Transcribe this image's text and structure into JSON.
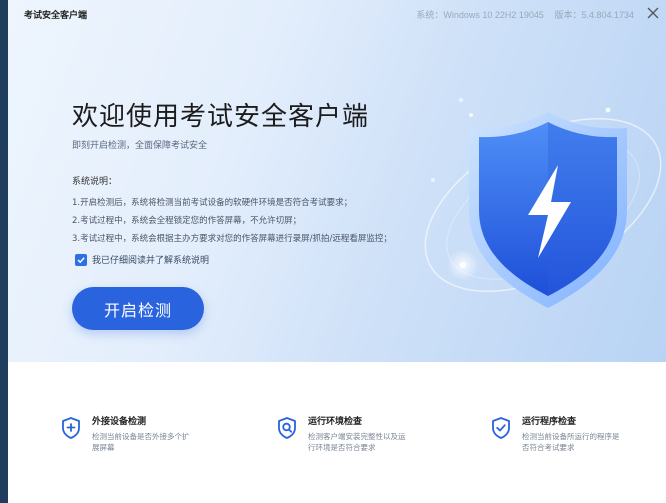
{
  "window": {
    "app_title": "考试安全客户端",
    "system_label": "系统：Windows 10 22H2 19045",
    "version_label": "版本：5.4.804.1734"
  },
  "hero": {
    "title": "欢迎使用考试安全客户端",
    "subtitle": "即刻开启检测，全面保障考试安全",
    "notes_title": "系统说明：",
    "notes": [
      "1.开启检测后，系统将检测当前考试设备的软硬件环境是否符合考试要求；",
      "2.考试过程中，系统会全程锁定您的作答屏幕，不允许切屏；",
      "3.考试过程中，系统会根据主办方要求对您的作答屏幕进行录屏/抓拍/远程看屏监控；"
    ],
    "agree_label": "我已仔细阅读并了解系统说明",
    "agree_checked": true,
    "start_button": "开启检测"
  },
  "features": [
    {
      "icon": "shield-plus-icon",
      "title": "外接设备检测",
      "desc": "检测当前设备是否外接多个扩展屏幕"
    },
    {
      "icon": "shield-search-icon",
      "title": "运行环境检查",
      "desc": "检测客户端安装完整性以及运行环境是否符合要求"
    },
    {
      "icon": "shield-check-icon",
      "title": "运行程序检查",
      "desc": "检测当前设备所运行的程序是否符合考试要求"
    }
  ],
  "colors": {
    "accent": "#2a63de",
    "background": "#1f3d5c"
  }
}
